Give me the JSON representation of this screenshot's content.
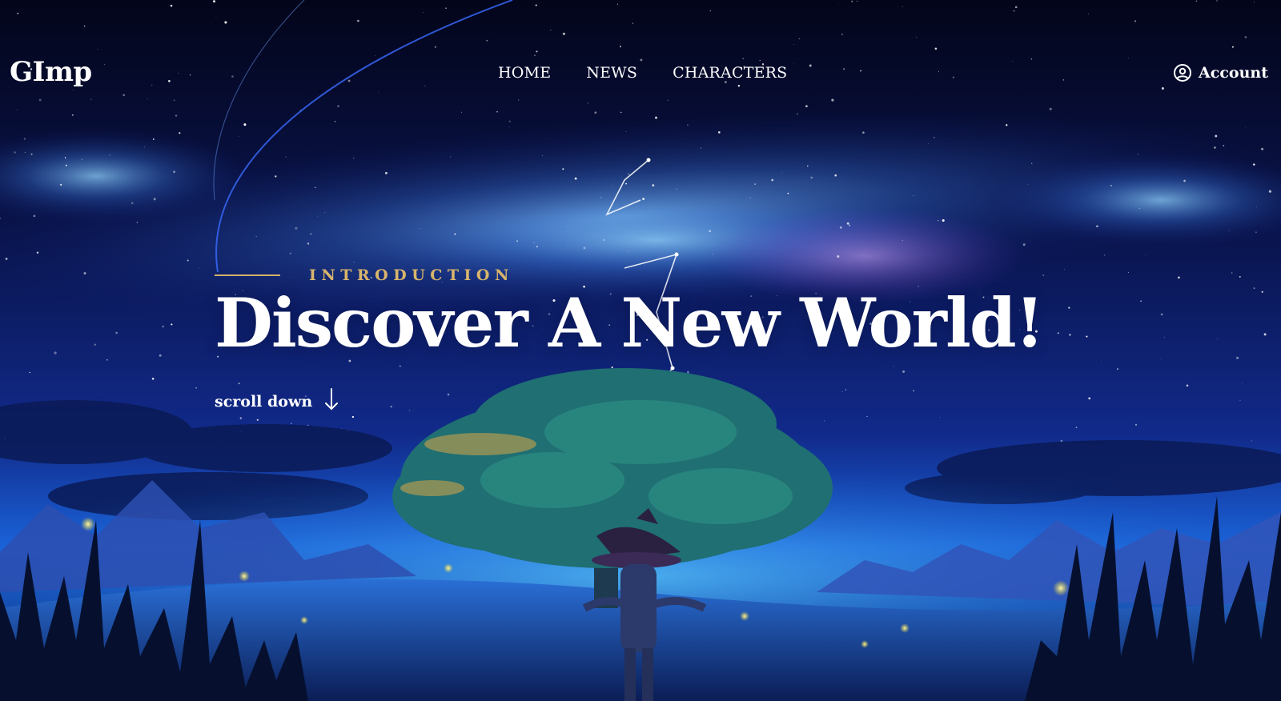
{
  "nav": {
    "logo": "GImp",
    "links": [
      "HOME",
      "NEWS",
      "CHARACTERS"
    ],
    "account_label": "Account"
  },
  "hero": {
    "kicker": "INTRODUCTION",
    "title": "Discover A New World!",
    "scroll_label": "scroll down"
  },
  "icons": {
    "account": "user-circle-icon",
    "scroll": "arrow-down-icon"
  },
  "colors": {
    "accent_gold": "#d8b56c",
    "text": "#ffffff",
    "sky_top": "#04061a",
    "sky_glow": "#3aa3ff"
  }
}
